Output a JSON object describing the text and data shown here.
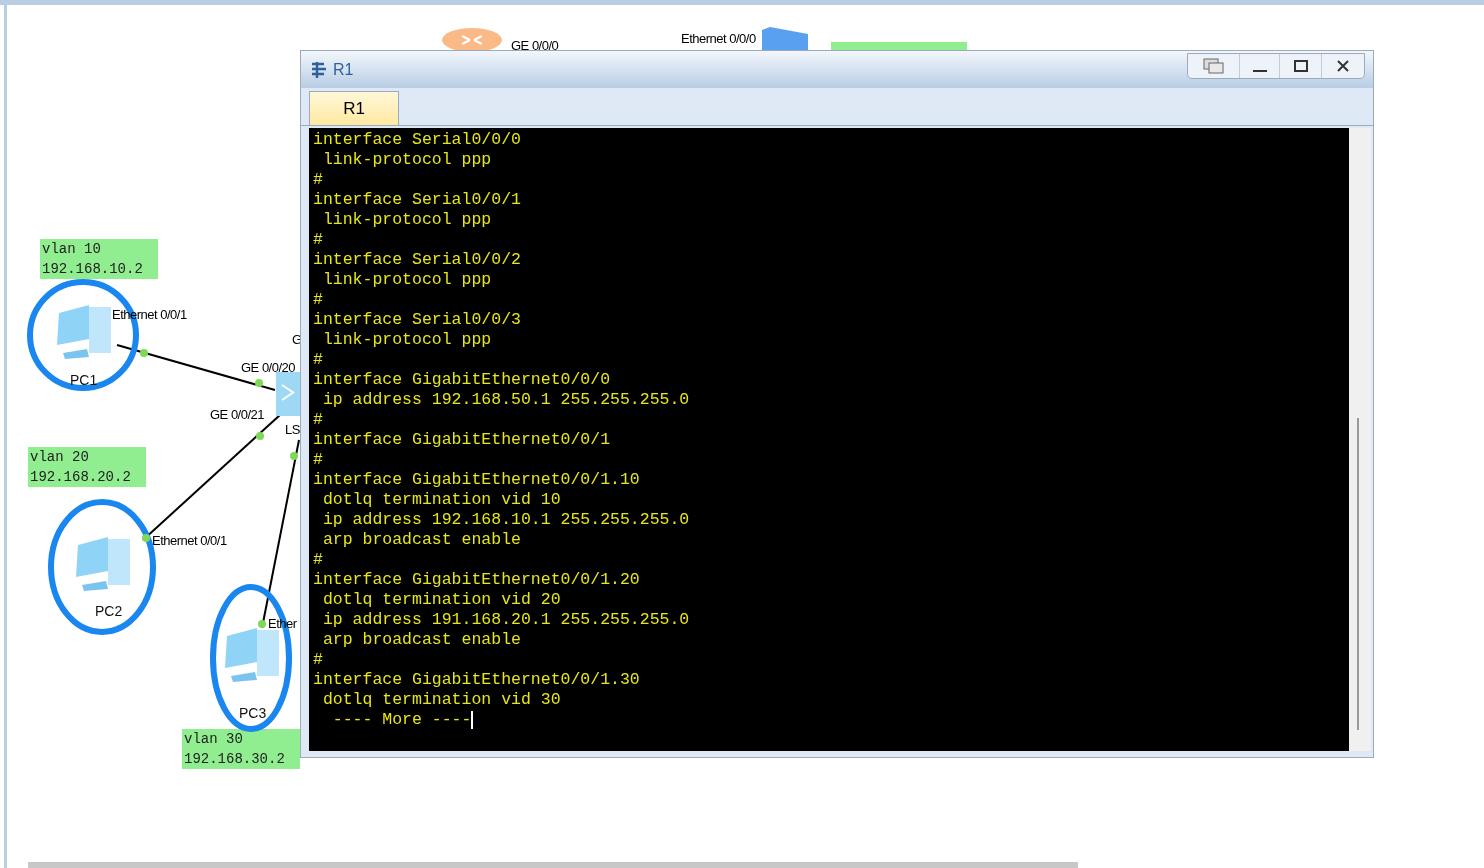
{
  "topology": {
    "top_labels": [
      "GE 0/0/0",
      "Ethernet 0/0/0"
    ],
    "notes": [
      {
        "lines": [
          "vlan 10",
          "192.168.10.2"
        ]
      },
      {
        "lines": [
          "vlan 20",
          "192.168.20.2"
        ]
      },
      {
        "lines": [
          "vlan 30",
          "192.168.30.2"
        ]
      }
    ],
    "pcs": [
      {
        "name": "PC1"
      },
      {
        "name": "PC2"
      },
      {
        "name": "PC3"
      }
    ],
    "port_labels": [
      "Ethernet 0/0/1",
      "G",
      "GE 0/0/20",
      "GE 0/0/21",
      "LS",
      "Ethernet 0/0/1",
      "Ether"
    ]
  },
  "window": {
    "title": "R1",
    "tabs": [
      {
        "label": "R1",
        "selected": true
      }
    ],
    "terminal_lines": [
      "interface Serial0/0/0",
      " link-protocol ppp",
      "#",
      "interface Serial0/0/1",
      " link-protocol ppp",
      "#",
      "interface Serial0/0/2",
      " link-protocol ppp",
      "#",
      "interface Serial0/0/3",
      " link-protocol ppp",
      "#",
      "interface GigabitEthernet0/0/0",
      " ip address 192.168.50.1 255.255.255.0",
      "#",
      "interface GigabitEthernet0/0/1",
      "#",
      "interface GigabitEthernet0/0/1.10",
      " dotlq termination vid 10",
      " ip address 192.168.10.1 255.255.255.0",
      " arp broadcast enable",
      "#",
      "interface GigabitEthernet0/0/1.20",
      " dotlq termination vid 20",
      " ip address 191.168.20.1 255.255.255.0",
      " arp broadcast enable",
      "#",
      "interface GigabitEthernet0/0/1.30",
      " dotlq termination vid 30"
    ],
    "more_prompt": "  ---- More ----"
  }
}
